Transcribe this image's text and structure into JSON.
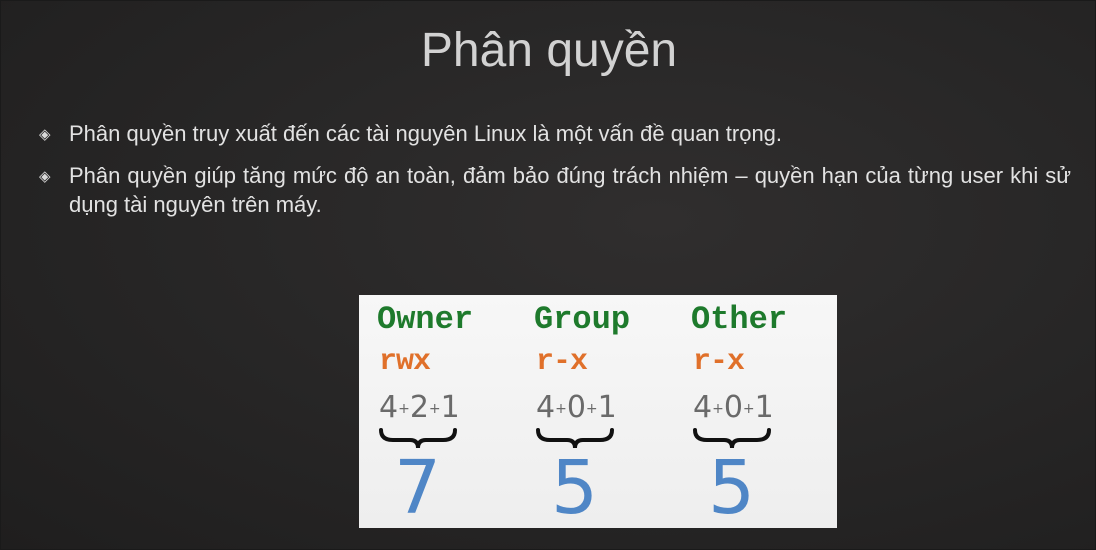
{
  "slide": {
    "title": "Phân quyền",
    "bullets": [
      {
        "icon": "diamond-bullet-icon",
        "text": "Phân quyền truy xuất đến các tài nguyên Linux là một vấn đề quan trọng."
      },
      {
        "icon": "diamond-bullet-icon",
        "text": "Phân quyền giúp tăng mức độ an toàn, đảm bảo đúng trách nhiệm – quyền hạn của từng user khi sử dụng tài nguyên trên máy."
      }
    ]
  },
  "permissions": {
    "colors": {
      "name": "#1e7a2c",
      "perm": "#e0702a",
      "sum": "#6a6a6a",
      "value": "#4f86c6"
    },
    "columns": [
      {
        "name": "Owner",
        "perm": "rwx",
        "digits": [
          "4",
          "2",
          "1"
        ],
        "value": "7"
      },
      {
        "name": "Group",
        "perm": "r-x",
        "digits": [
          "4",
          "0",
          "1"
        ],
        "value": "5"
      },
      {
        "name": "Other",
        "perm": "r-x",
        "digits": [
          "4",
          "0",
          "1"
        ],
        "value": "5"
      }
    ]
  }
}
